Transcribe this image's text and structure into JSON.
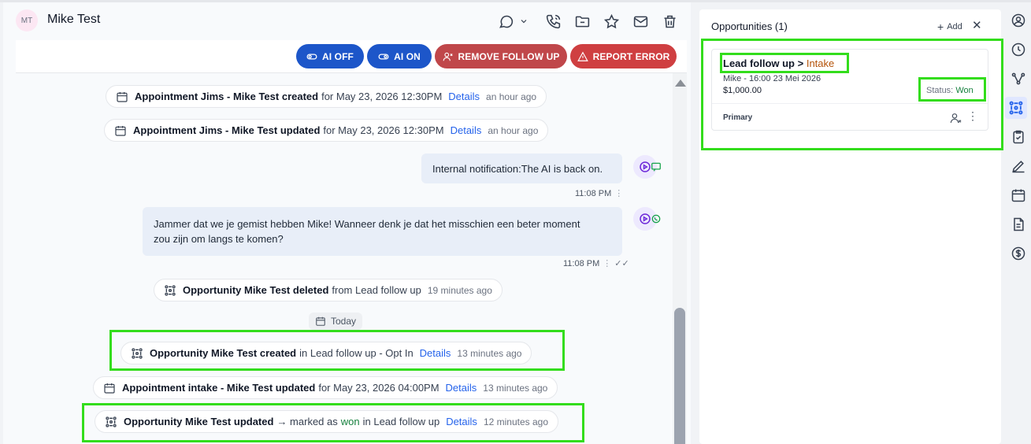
{
  "contact": {
    "initials": "MT",
    "name": "Mike Test"
  },
  "header_icons": [
    "chat-bubble-icon",
    "chevron-down-icon",
    "phone-icon",
    "folder-icon",
    "star-icon",
    "mail-icon",
    "trash-icon"
  ],
  "buttons": {
    "ai_off": "AI OFF",
    "ai_on": "AI ON",
    "remove_follow_up": "REMOVE FOLLOW UP",
    "report_error": "REPORT ERROR"
  },
  "events": [
    {
      "title": "Appointment Jims - Mike Test created",
      "rest": "for May 23, 2026 12:30PM",
      "link": "Details",
      "time": "an hour ago"
    },
    {
      "title": "Appointment Jims - Mike Test updated",
      "rest": "for May 23, 2026 12:30PM",
      "link": "Details",
      "time": "an hour ago"
    },
    {
      "title": "Opportunity Mike Test deleted",
      "rest": "from Lead follow up",
      "time": "19 minutes ago"
    },
    {
      "title": "Opportunity Mike Test created",
      "rest": "in Lead follow up - Opt In",
      "link": "Details",
      "time": "13 minutes ago"
    },
    {
      "title": "Appointment intake - Mike Test updated",
      "rest": "for May 23, 2026 04:00PM",
      "link": "Details",
      "time": "13 minutes ago"
    },
    {
      "title": "Opportunity Mike Test updated",
      "rest_before": "→ marked as",
      "won": "won",
      "rest": "in Lead follow up",
      "link": "Details",
      "time": "12 minutes ago"
    }
  ],
  "messages": [
    {
      "text": "Internal notification:The AI is back on.",
      "time": "11:08 PM"
    },
    {
      "line1": "Jammer dat we je gemist hebben Mike! Wanneer denk je dat het misschien een beter moment",
      "line2": "zou zijn om langs te komen?",
      "time": "11:08 PM"
    }
  ],
  "divider": {
    "today": "Today"
  },
  "opportunities": {
    "title": "Opportunities (1)",
    "add": "Add",
    "card": {
      "pipeline": "Lead follow up >",
      "stage": "Intake",
      "subtitle": "Mike - 16:00 23 Mei 2026",
      "amount": "$1,000.00",
      "status_label": "Status:",
      "status_value": "Won",
      "primary": "Primary"
    }
  },
  "colors": {
    "highlight": "#33dd1c",
    "ai_button": "#1d56c9",
    "remove_button": "#c0474a",
    "report_button": "#cf3f41",
    "link": "#2563eb",
    "won": "#15803d"
  },
  "rail_icons": [
    "user-circle-icon",
    "clock-icon",
    "workflow-icon",
    "opportunity-icon",
    "task-icon",
    "pen-icon",
    "calendar-icon",
    "document-icon",
    "dollar-icon"
  ]
}
